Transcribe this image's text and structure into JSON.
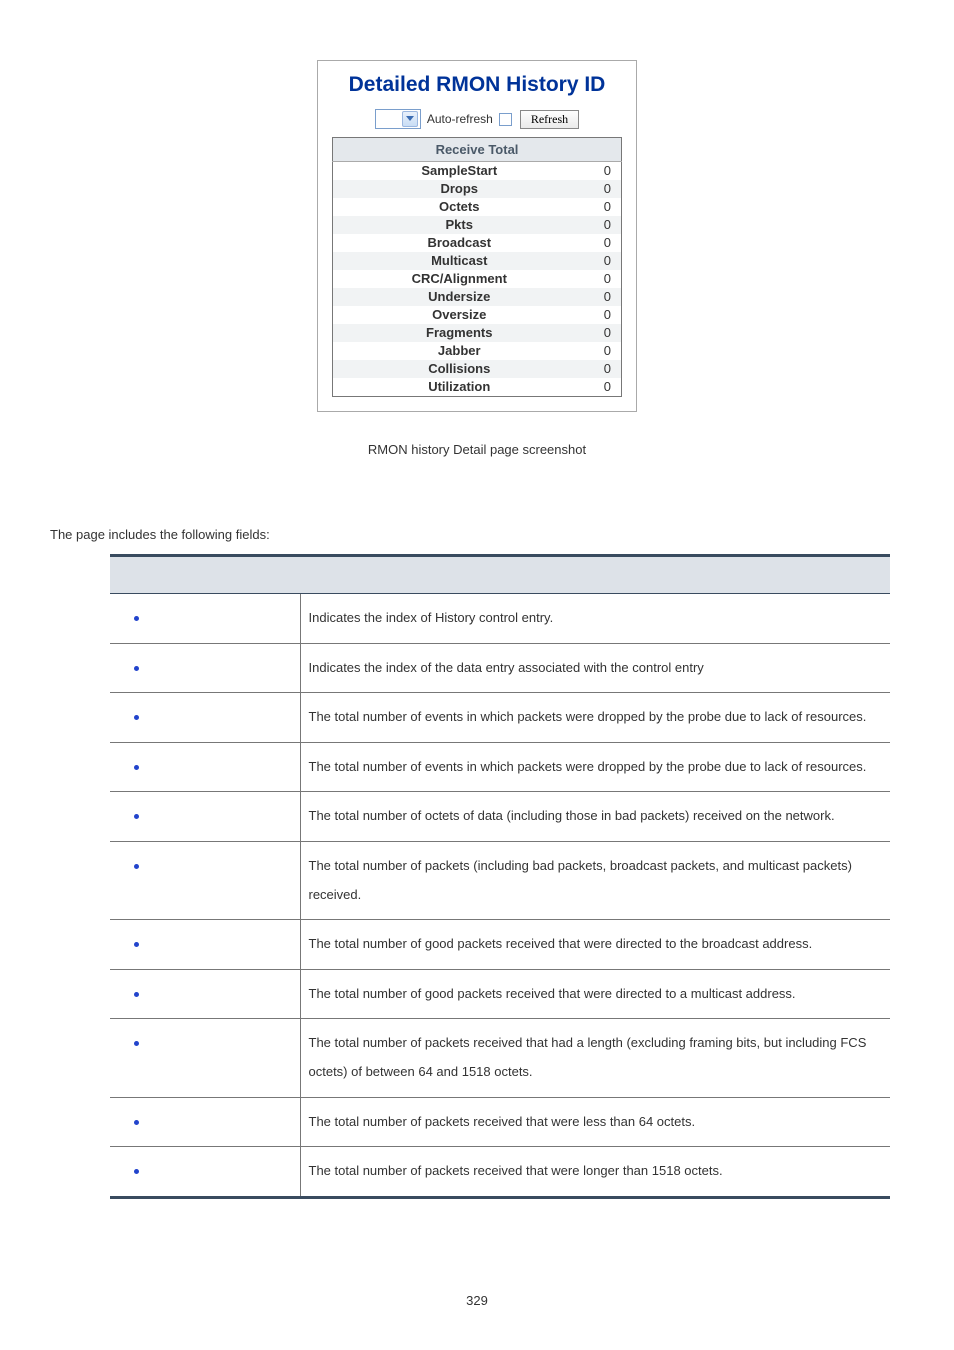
{
  "screenshot": {
    "title": "Detailed RMON History  ID",
    "auto_refresh_label": "Auto-refresh",
    "refresh_button": "Refresh",
    "table_header": "Receive Total",
    "rows": [
      {
        "label": "SampleStart",
        "value": "0"
      },
      {
        "label": "Drops",
        "value": "0"
      },
      {
        "label": "Octets",
        "value": "0"
      },
      {
        "label": "Pkts",
        "value": "0"
      },
      {
        "label": "Broadcast",
        "value": "0"
      },
      {
        "label": "Multicast",
        "value": "0"
      },
      {
        "label": "CRC/Alignment",
        "value": "0"
      },
      {
        "label": "Undersize",
        "value": "0"
      },
      {
        "label": "Oversize",
        "value": "0"
      },
      {
        "label": "Fragments",
        "value": "0"
      },
      {
        "label": "Jabber",
        "value": "0"
      },
      {
        "label": "Collisions",
        "value": "0"
      },
      {
        "label": "Utilization",
        "value": "0"
      }
    ]
  },
  "caption": "RMON history Detail page screenshot",
  "intro": "The page includes the following fields:",
  "fields": [
    {
      "desc": "Indicates the index of History control entry."
    },
    {
      "desc": "Indicates the index of the data entry associated with the control entry"
    },
    {
      "desc": "The total number of events in which packets were dropped by the probe due to lack of resources."
    },
    {
      "desc": "The total number of events in which packets were dropped by the probe due to lack of resources."
    },
    {
      "desc": "The total number of octets of data (including those in bad packets) received on the network."
    },
    {
      "desc": "The total number of packets (including bad packets, broadcast packets, and multicast packets) received."
    },
    {
      "desc": "The total number of good packets received that were directed to the broadcast address."
    },
    {
      "desc": "The total number of good packets received that were directed to a multicast address."
    },
    {
      "desc": "The total number of packets received that had a length (excluding framing bits, but including FCS octets) of between 64 and 1518 octets."
    },
    {
      "desc": "The total number of packets received that were less than 64 octets."
    },
    {
      "desc": "The total number of packets received that were longer than 1518 octets."
    }
  ],
  "page_number": "329"
}
